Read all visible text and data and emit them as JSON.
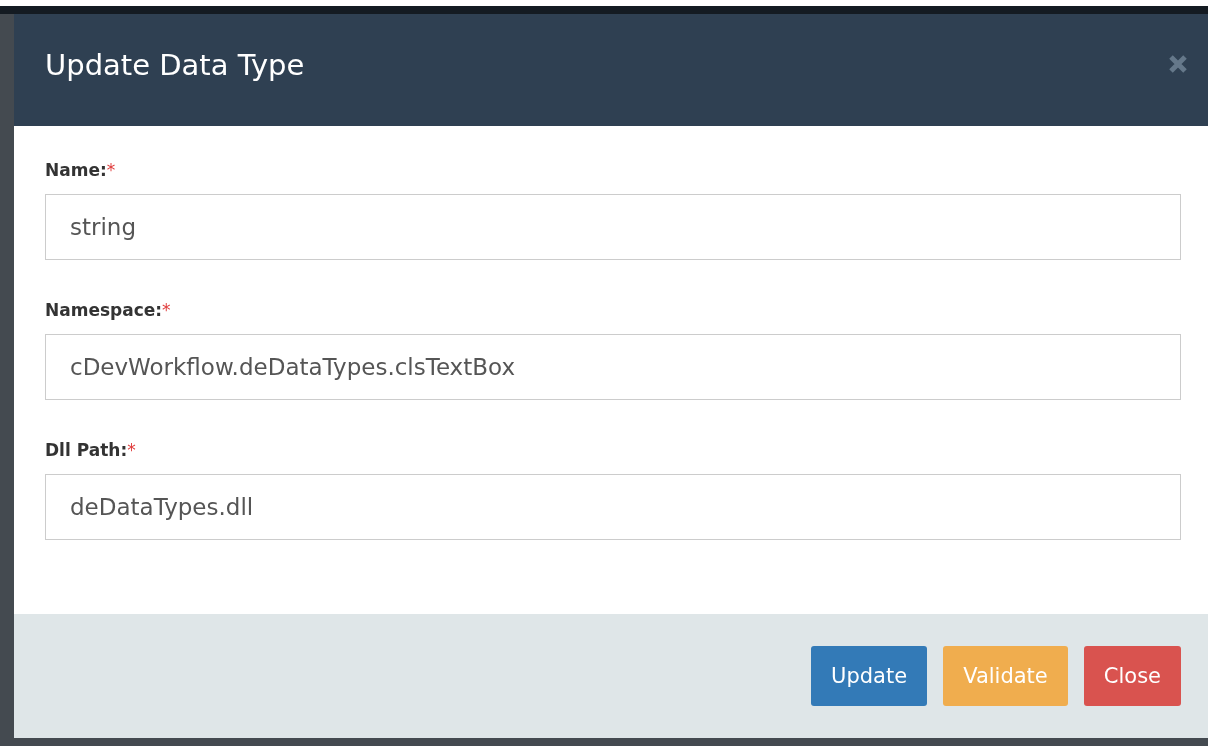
{
  "dialog": {
    "title": "Update Data Type",
    "required_mark": "*",
    "fields": [
      {
        "label": "Name:",
        "required": true,
        "value": "string"
      },
      {
        "label": "Namespace:",
        "required": true,
        "value": "cDevWorkflow.deDataTypes.clsTextBox"
      },
      {
        "label": "Dll Path:",
        "required": true,
        "value": "deDataTypes.dll"
      }
    ],
    "buttons": [
      {
        "label": "Update",
        "kind": "primary"
      },
      {
        "label": "Validate",
        "kind": "warning"
      },
      {
        "label": "Close",
        "kind": "danger"
      }
    ]
  }
}
